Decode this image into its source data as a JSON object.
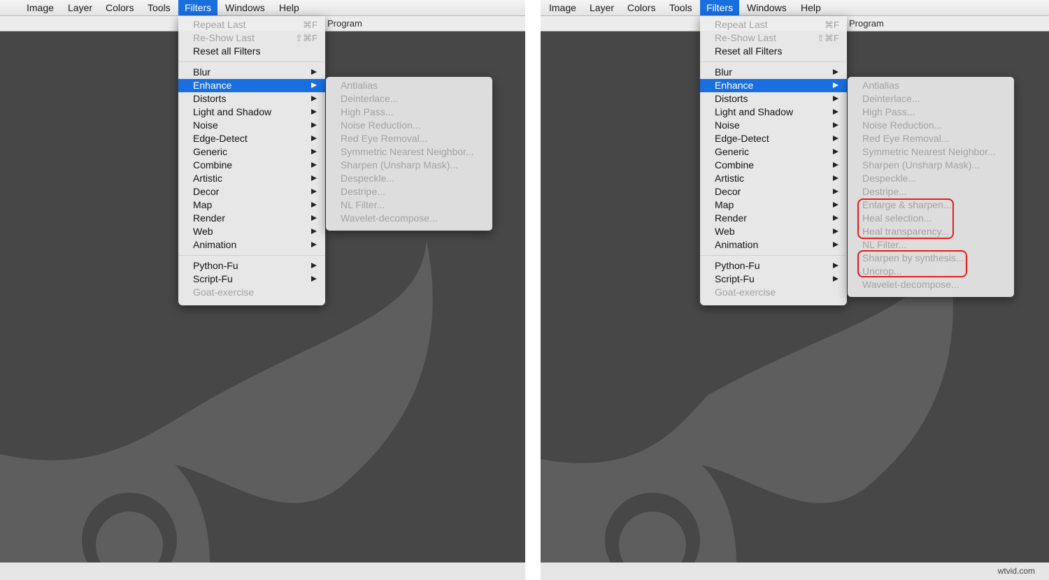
{
  "menubar": {
    "items": [
      "Image",
      "Layer",
      "Colors",
      "Tools",
      "Filters",
      "Windows",
      "Help"
    ],
    "active": "Filters"
  },
  "subbar_text": "Program",
  "filters_menu": {
    "group1": [
      {
        "label": "Repeat Last",
        "shortcut": "⌘F",
        "disabled": true
      },
      {
        "label": "Re-Show Last",
        "shortcut": "⇧⌘F",
        "disabled": true
      },
      {
        "label": "Reset all Filters",
        "disabled": false
      }
    ],
    "group2": [
      "Blur",
      "Enhance",
      "Distorts",
      "Light and Shadow",
      "Noise",
      "Edge-Detect",
      "Generic",
      "Combine",
      "Artistic",
      "Decor",
      "Map",
      "Render",
      "Web",
      "Animation"
    ],
    "selected": "Enhance",
    "group3": [
      {
        "label": "Python-Fu",
        "submenu": true,
        "disabled": false
      },
      {
        "label": "Script-Fu",
        "submenu": true,
        "disabled": false
      },
      {
        "label": "Goat-exercise",
        "submenu": false,
        "disabled": true
      }
    ]
  },
  "enhance_before": [
    "Antialias",
    "Deinterlace...",
    "High Pass...",
    "Noise Reduction...",
    "Red Eye Removal...",
    "Symmetric Nearest Neighbor...",
    "Sharpen (Unsharp Mask)...",
    "Despeckle...",
    "Destripe...",
    "NL Filter...",
    "Wavelet-decompose..."
  ],
  "enhance_after": [
    "Antialias",
    "Deinterlace...",
    "High Pass...",
    "Noise Reduction...",
    "Red Eye Removal...",
    "Symmetric Nearest Neighbor...",
    "Sharpen (Unsharp Mask)...",
    "Despeckle...",
    "Destripe...",
    "Enlarge & sharpen...",
    "Heal selection...",
    "Heal transparency...",
    "NL Filter...",
    "Sharpen by synthesis...",
    "Uncrop...",
    "Wavelet-decompose..."
  ],
  "colors": {
    "accent": "#1a6fe0",
    "canvas": "#474747",
    "shape": "#5e5e5e",
    "highlight": "#e41c1c"
  },
  "watermark": "wtvid.com"
}
